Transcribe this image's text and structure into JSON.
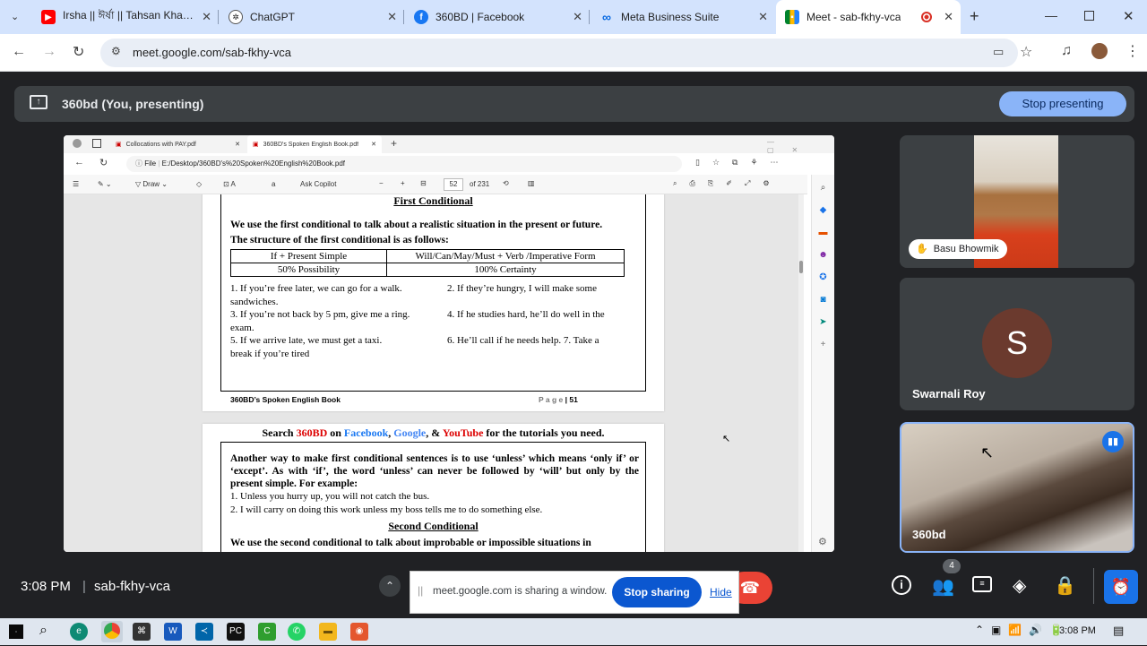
{
  "browser": {
    "tabs": [
      {
        "title": "Irsha || ঈর্ষা || Tahsan Khan ||",
        "icon": "youtube-icon"
      },
      {
        "title": "ChatGPT",
        "icon": "chatgpt-icon"
      },
      {
        "title": "360BD | Facebook",
        "icon": "facebook-icon"
      },
      {
        "title": "Meta Business Suite",
        "icon": "meta-icon"
      },
      {
        "title": "Meet - sab-fkhy-vca",
        "icon": "meet-icon",
        "active": true
      }
    ],
    "url": "meet.google.com/sab-fkhy-vca"
  },
  "meet": {
    "presenting_label": "360bd (You, presenting)",
    "stop_presenting": "Stop presenting",
    "time": "3:08 PM",
    "meeting_code": "sab-fkhy-vca",
    "participants_count": "4",
    "participants": [
      {
        "name": "Basu Bhowmik"
      },
      {
        "name": "Swarnali Roy",
        "initial": "S"
      },
      {
        "name": "360bd"
      }
    ],
    "share_banner": {
      "text": "meet.google.com is sharing a window.",
      "stop_sharing": "Stop sharing",
      "hide": "Hide"
    }
  },
  "shared_window": {
    "tabs": [
      "Collocations with PAY.pdf",
      "360BD's Spoken English Book.pdf"
    ],
    "file_label": "File",
    "path": "E:/Desktop/360BD's%20Spoken%20English%20Book.pdf",
    "toolbar": {
      "draw": "Draw",
      "ask_copilot": "Ask Copilot",
      "page": "52",
      "of_pages": "of 231"
    },
    "page1": {
      "heading": "First Conditional",
      "intro": "We use the first conditional to talk about a realistic situation in the present or future.",
      "structure": "The structure of the first conditional is as follows:",
      "table": [
        [
          "If + Present Simple",
          "Will/Can/May/Must + Verb /Imperative Form"
        ],
        [
          "50% Possibility",
          "100% Certainty"
        ]
      ],
      "examples": [
        [
          "1. If you’re free later, we can go for a walk.",
          "2. If they’re hungry, I will make some"
        ],
        [
          "sandwiches.",
          ""
        ],
        [
          "3. If you’re not back by 5 pm, give me a ring.",
          "4. If he studies hard, he’ll do well in the"
        ],
        [
          "exam.",
          ""
        ],
        [
          "5. If we arrive late, we must get a taxi.",
          "6. He’ll call if he needs help. 7. Take a"
        ],
        [
          "break if you’re tired",
          ""
        ]
      ],
      "footer_left": "360BD’s Spoken English Book",
      "footer_page_label": "P a g e",
      "footer_page_num": "| 51"
    },
    "page2": {
      "search_prefix": "Search",
      "brand": "360BD",
      "on": "on",
      "facebook": "Facebook",
      "google": "Google",
      "amp": ", &",
      "youtube": "YouTube",
      "suffix": "for the tutorials you need.",
      "para": "Another way to make first conditional sentences is to use ‘unless’ which means ‘only if’ or ‘except’. As with ‘if’, the word ‘unless’ can never be followed by ‘will’ but only by the present simple. For example:",
      "ex1": "1. Unless you hurry up, you will not catch the bus.",
      "ex2": "2. I will carry on doing this work unless my boss tells me to do something else.",
      "heading2": "Second Conditional",
      "cut_line": "We use the second conditional to talk about improbable or impossible situations in"
    }
  },
  "taskbar": {
    "time": "3:08 PM"
  },
  "colors": {
    "meet_bg": "#202124",
    "accent": "#8ab4f8",
    "end_call": "#ea4335",
    "share_btn": "#0b57d0"
  }
}
